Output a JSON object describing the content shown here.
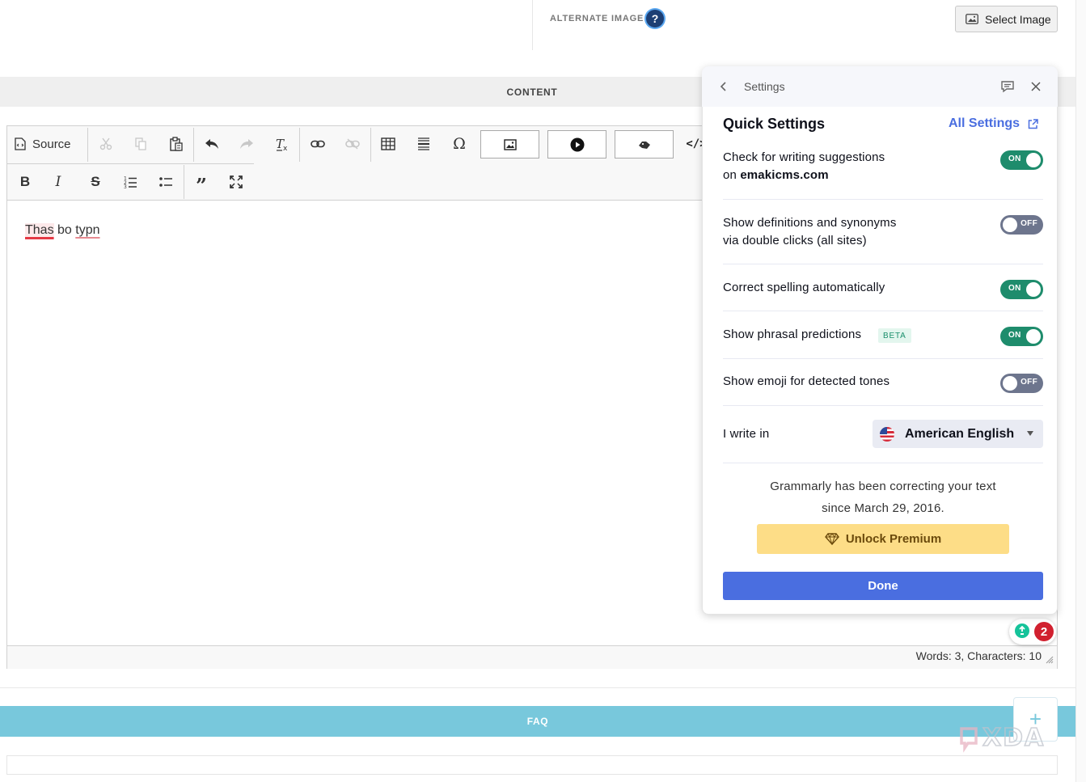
{
  "top": {
    "alternate_image_label": "ALTERNATE IMAGE",
    "help_icon": "?",
    "select_image_label": "Select Image"
  },
  "content_section": {
    "label": "CONTENT"
  },
  "editor": {
    "toolbar": {
      "source_label": "Source",
      "icons": [
        "source-icon",
        "cut-icon",
        "copy-icon",
        "paste-icon",
        "undo-icon",
        "redo-icon",
        "remove-format-icon",
        "link-icon",
        "unlink-icon",
        "table-icon",
        "horizontal-line-icon",
        "special-char-icon",
        "image-icon",
        "video-icon",
        "embed-icon",
        "code-icon",
        "bold-icon",
        "italic-icon",
        "strikethrough-icon",
        "numbered-list-icon",
        "bulleted-list-icon",
        "blockquote-icon",
        "maximize-icon"
      ]
    },
    "text": {
      "word1": "Thas",
      "word2": "bo",
      "word3": "typn"
    },
    "word_count": "Words: 3, Characters: 10"
  },
  "grammarly_button": {
    "count": "2"
  },
  "faq_section": {
    "label": "FAQ"
  },
  "watermark": "XDA",
  "panel": {
    "title": "Settings",
    "quick_settings_title": "Quick Settings",
    "all_settings_label": "All Settings",
    "settings": [
      {
        "line1": "Check for writing suggestions",
        "line2_prefix": "on ",
        "line2_bold": "emakicms.com",
        "state": "ON"
      },
      {
        "line1": "Show definitions and synonyms",
        "line2": "via double clicks (all sites)",
        "state": "OFF"
      },
      {
        "line1": "Correct spelling automatically",
        "state": "ON"
      },
      {
        "line1": "Show phrasal predictions",
        "badge": "BETA",
        "state": "ON"
      },
      {
        "line1": "Show emoji for detected tones",
        "state": "OFF"
      }
    ],
    "language_label": "I write in",
    "language_value": "American English",
    "since_line1": "Grammarly has been correcting your text",
    "since_line2": "since March 29, 2016.",
    "premium_label": "Unlock Premium",
    "done_label": "Done"
  },
  "colors": {
    "accent_blue": "#4a6ee0",
    "toggle_on": "#1e8c6c",
    "toggle_off": "#6d758d",
    "premium_yellow": "#fddd87",
    "faq_bar": "#78c8dc",
    "error_red": "#d1202f"
  }
}
